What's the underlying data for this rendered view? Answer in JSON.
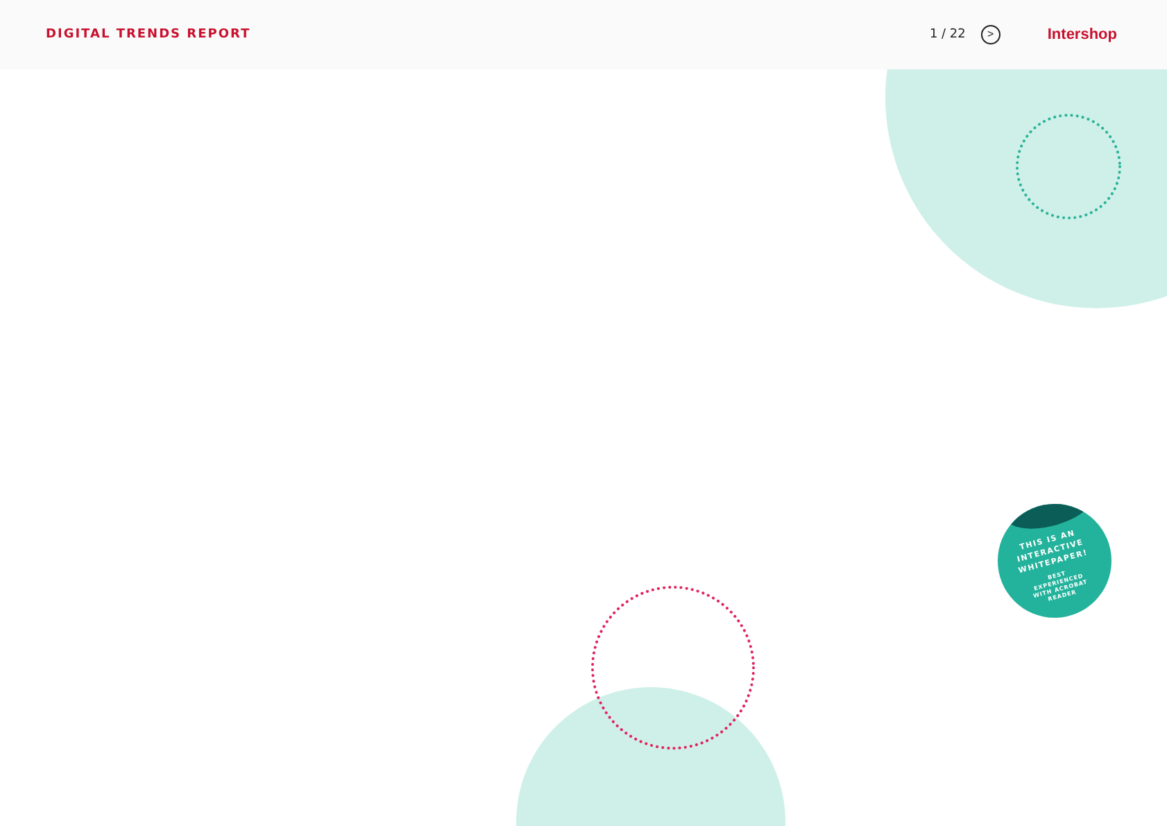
{
  "header": {
    "title": "DIGITAL TRENDS REPORT",
    "page_counter": "1 / 22",
    "next": ">",
    "logo": "Intershop"
  },
  "badge": {
    "headline": "THIS IS AN INTERACTIVE WHITEPAPER!",
    "note": "BEST EXPERIENCED WITH ACROBAT READER"
  }
}
